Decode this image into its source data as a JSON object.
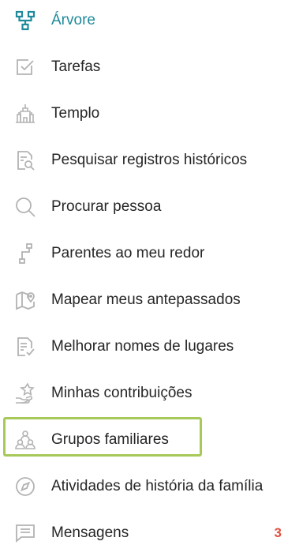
{
  "colors": {
    "active": "#1f8a9c",
    "text": "#262626",
    "icon": "#b3b3b3",
    "badge": "#e05040",
    "highlight": "#a6c95a"
  },
  "menu": {
    "items": [
      {
        "label": "Árvore",
        "icon": "tree-icon",
        "active": true
      },
      {
        "label": "Tarefas",
        "icon": "checkbox-icon"
      },
      {
        "label": "Templo",
        "icon": "temple-icon"
      },
      {
        "label": "Pesquisar registros históricos",
        "icon": "document-search-icon"
      },
      {
        "label": "Procurar pessoa",
        "icon": "search-icon"
      },
      {
        "label": "Parentes ao meu redor",
        "icon": "relatives-icon"
      },
      {
        "label": "Mapear meus antepassados",
        "icon": "map-pin-icon"
      },
      {
        "label": "Melhorar nomes de lugares",
        "icon": "document-check-icon"
      },
      {
        "label": "Minhas contribuições",
        "icon": "hand-star-icon"
      },
      {
        "label": "Grupos familiares",
        "icon": "family-group-icon",
        "highlighted": true
      },
      {
        "label": "Atividades de história da família",
        "icon": "compass-icon"
      },
      {
        "label": "Mensagens",
        "icon": "message-icon",
        "badge": "3"
      }
    ]
  }
}
